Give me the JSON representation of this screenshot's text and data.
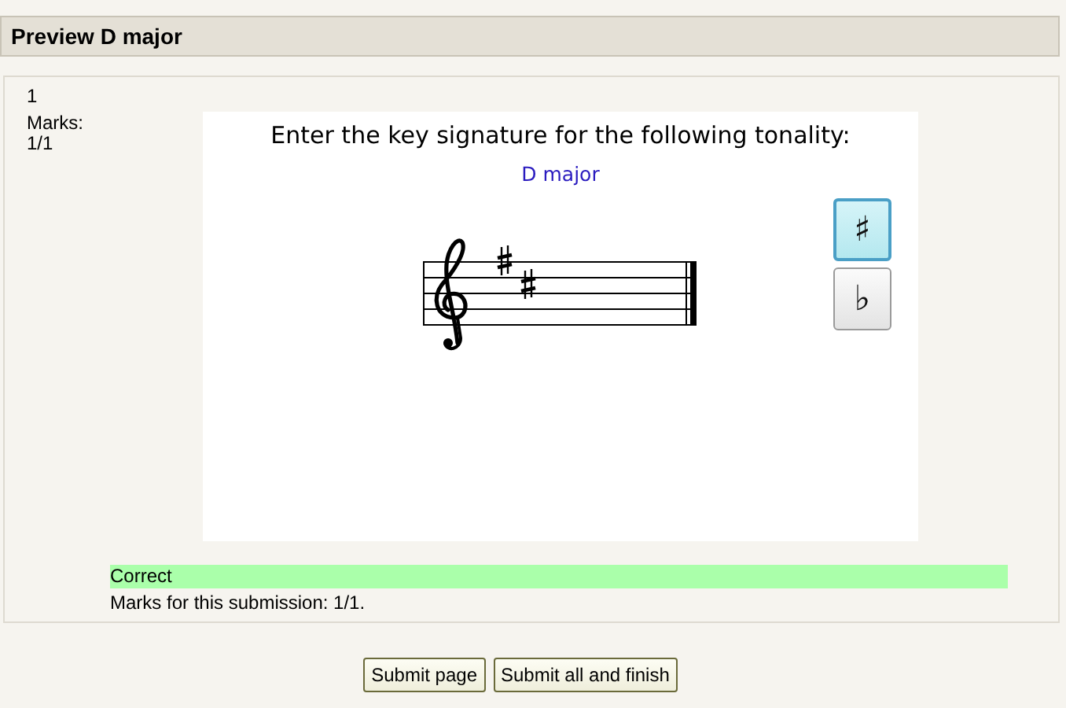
{
  "header": {
    "title": "Preview D major"
  },
  "question": {
    "number": "1",
    "marks_label": "Marks:",
    "marks_value": "1/1",
    "prompt": "Enter the key signature for the following tonality:",
    "tonality": "D major",
    "key_signature": [
      {
        "kind": "sharp"
      },
      {
        "kind": "sharp"
      }
    ],
    "accidental_buttons": [
      {
        "symbol": "♯",
        "selected": true
      },
      {
        "symbol": "♭",
        "selected": false
      }
    ],
    "feedback": {
      "result": "Correct",
      "correct": true,
      "marks": "Marks for this submission: 1/1."
    }
  },
  "buttons": [
    "Submit page",
    "Submit all and finish"
  ]
}
